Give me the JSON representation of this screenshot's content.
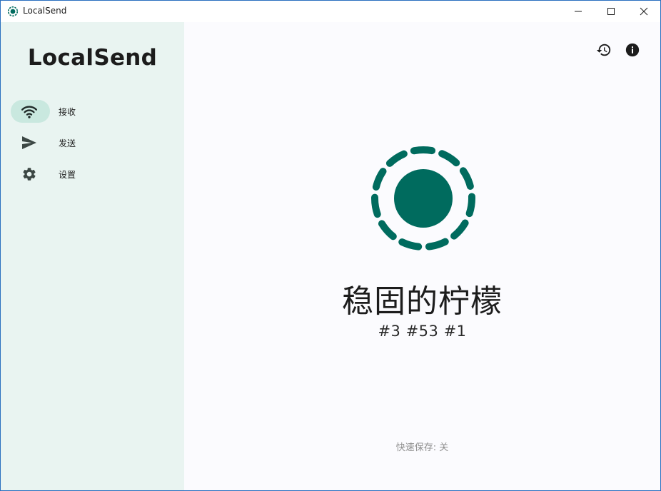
{
  "window": {
    "title": "LocalSend",
    "controls": {
      "minimize": "minimize",
      "maximize": "maximize",
      "close": "close"
    }
  },
  "sidebar": {
    "title": "LocalSend",
    "items": [
      {
        "label": "接收",
        "icon": "wifi-icon",
        "active": true
      },
      {
        "label": "发送",
        "icon": "send-icon",
        "active": false
      },
      {
        "label": "设置",
        "icon": "gear-icon",
        "active": false
      }
    ]
  },
  "main": {
    "actions": {
      "history_icon": "history-icon",
      "info_icon": "info-icon"
    },
    "device_name": "稳固的柠檬",
    "device_ids": "#3 #53 #1",
    "quick_save": "快速保存: 关"
  },
  "colors": {
    "accent": "#006b5e",
    "sidebar_bg": "#e9f4f1",
    "active_pill": "#c9e8df",
    "main_bg": "#fbfbfe",
    "muted_text": "#8e8e8e"
  }
}
